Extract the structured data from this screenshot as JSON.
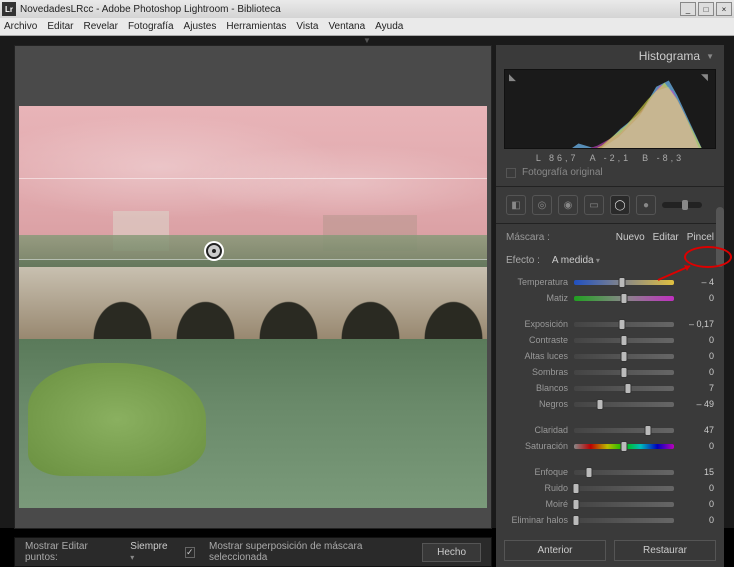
{
  "title": "NovedadesLRcc - Adobe Photoshop Lightroom - Biblioteca",
  "menu": [
    "Archivo",
    "Editar",
    "Revelar",
    "Fotografía",
    "Ajustes",
    "Herramientas",
    "Vista",
    "Ventana",
    "Ayuda"
  ],
  "panel_title": "Histograma",
  "hist_readout": {
    "L": "86,7",
    "A": "-2,1",
    "B": "-8,3",
    "L_label": "L",
    "A_label": "A",
    "B_label": "B"
  },
  "original_label": "Fotografía original",
  "mask": {
    "label": "Máscara :",
    "nuevo": "Nuevo",
    "editar": "Editar",
    "pincel": "Pincel"
  },
  "effect": {
    "label": "Efecto :",
    "value": "A medida"
  },
  "sliders": [
    {
      "name": "Temperatura",
      "value": "– 4",
      "pos": 48,
      "cls": "temp"
    },
    {
      "name": "Matiz",
      "value": "0",
      "pos": 50,
      "cls": "tint"
    },
    {
      "gap": true
    },
    {
      "name": "Exposición",
      "value": "– 0,17",
      "pos": 48,
      "cls": ""
    },
    {
      "name": "Contraste",
      "value": "0",
      "pos": 50,
      "cls": ""
    },
    {
      "name": "Altas luces",
      "value": "0",
      "pos": 50,
      "cls": ""
    },
    {
      "name": "Sombras",
      "value": "0",
      "pos": 50,
      "cls": ""
    },
    {
      "name": "Blancos",
      "value": "7",
      "pos": 54,
      "cls": ""
    },
    {
      "name": "Negros",
      "value": "– 49",
      "pos": 26,
      "cls": ""
    },
    {
      "gap": true
    },
    {
      "name": "Claridad",
      "value": "47",
      "pos": 74,
      "cls": ""
    },
    {
      "name": "Saturación",
      "value": "0",
      "pos": 50,
      "cls": "sat"
    },
    {
      "gap": true
    },
    {
      "name": "Enfoque",
      "value": "15",
      "pos": 15,
      "cls": ""
    },
    {
      "name": "Ruido",
      "value": "0",
      "pos": 2,
      "cls": ""
    },
    {
      "name": "Moiré",
      "value": "0",
      "pos": 2,
      "cls": ""
    },
    {
      "name": "Eliminar halos",
      "value": "0",
      "pos": 2,
      "cls": ""
    }
  ],
  "bottom": {
    "mostrar": "Mostrar Editar puntos:",
    "siempre": "Siempre",
    "overlay": "Mostrar superposición de máscara seleccionada",
    "hecho": "Hecho"
  },
  "footer": {
    "anterior": "Anterior",
    "restaurar": "Restaurar"
  },
  "app_icon": "Lr"
}
